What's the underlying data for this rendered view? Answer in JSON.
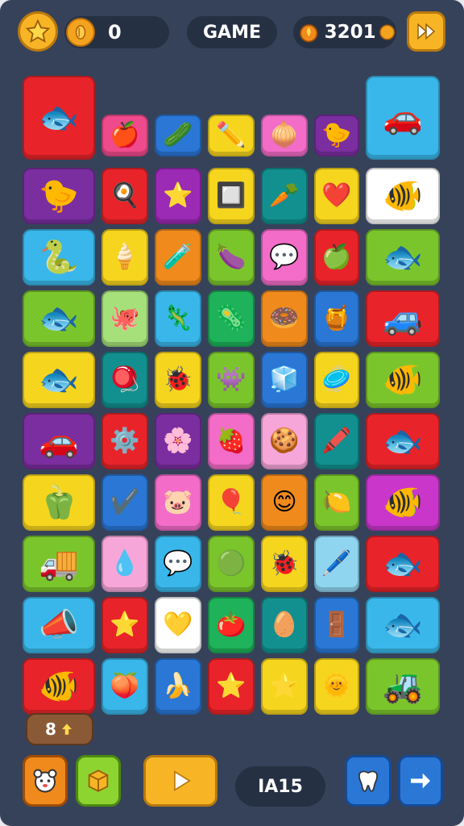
{
  "topbar": {
    "star_icon": "star-icon",
    "coins": "0",
    "title": "GAME",
    "score": "3201",
    "skip_icon": "skip-icon"
  },
  "board": {
    "rows": [
      [
        {
          "color": "#e8242a",
          "icon": "🐟",
          "span": 2,
          "name": "fish-car-tile"
        },
        {
          "color": "#ef4a8b",
          "icon": "🍎"
        },
        {
          "color": "#2a77d6",
          "icon": "🥒"
        },
        {
          "color": "#f6d51e",
          "icon": "✏️"
        },
        {
          "color": "#f26cc8",
          "icon": "🧅"
        },
        {
          "color": "#7b2ea0",
          "icon": "🐤"
        },
        {
          "color": "#39b7ea",
          "icon": "🚗",
          "span": 2,
          "name": "bird-car-tile"
        }
      ],
      [
        {
          "color": "#7b2ea0",
          "icon": "🐤"
        },
        {
          "color": "#e8242a",
          "icon": "🍳"
        },
        {
          "color": "#9b2ab4",
          "icon": "⭐"
        },
        {
          "color": "#f6d51e",
          "icon": "🔲"
        },
        {
          "color": "#12908f",
          "icon": "🥕"
        },
        {
          "color": "#f6d51e",
          "icon": "❤️"
        },
        {
          "color": "#ffffff",
          "icon": "🐠"
        }
      ],
      [
        {
          "color": "#39b7ea",
          "icon": "🐍"
        },
        {
          "color": "#f6d51e",
          "icon": "🍦"
        },
        {
          "color": "#f08a1c",
          "icon": "🧪"
        },
        {
          "color": "#7bc52c",
          "icon": "🍆"
        },
        {
          "color": "#f26cc8",
          "icon": "💬"
        },
        {
          "color": "#e8242a",
          "icon": "🍏"
        },
        {
          "color": "#7bc52c",
          "icon": "🐟"
        }
      ],
      [
        {
          "color": "#7bc52c",
          "icon": "🐟"
        },
        {
          "color": "#a5e07a",
          "icon": "🐙"
        },
        {
          "color": "#39b7ea",
          "icon": "🦎"
        },
        {
          "color": "#1eb25a",
          "icon": "🦠"
        },
        {
          "color": "#f08a1c",
          "icon": "🍩"
        },
        {
          "color": "#2a77d6",
          "icon": "🍯"
        },
        {
          "color": "#e8242a",
          "icon": "🚙"
        }
      ],
      [
        {
          "color": "#f6d51e",
          "icon": "🐟"
        },
        {
          "color": "#12908f",
          "icon": "🪀"
        },
        {
          "color": "#f6d51e",
          "icon": "🐞"
        },
        {
          "color": "#7bc52c",
          "icon": "👾"
        },
        {
          "color": "#2a77d6",
          "icon": "🧊"
        },
        {
          "color": "#f6d51e",
          "icon": "🥏"
        },
        {
          "color": "#7bc52c",
          "icon": "🐠"
        }
      ],
      [
        {
          "color": "#7b2ea0",
          "icon": "🚗"
        },
        {
          "color": "#e8242a",
          "icon": "⚙️"
        },
        {
          "color": "#7b2ea0",
          "icon": "🌸"
        },
        {
          "color": "#f26cc8",
          "icon": "🍓"
        },
        {
          "color": "#f6a6d8",
          "icon": "🍪"
        },
        {
          "color": "#12908f",
          "icon": "🖍️"
        },
        {
          "color": "#e8242a",
          "icon": "🐟"
        }
      ],
      [
        {
          "color": "#f6d51e",
          "icon": "🫑"
        },
        {
          "color": "#2a77d6",
          "icon": "✔️"
        },
        {
          "color": "#f26cc8",
          "icon": "🐷"
        },
        {
          "color": "#f6d51e",
          "icon": "🎈"
        },
        {
          "color": "#f08a1c",
          "icon": "😊"
        },
        {
          "color": "#7bc52c",
          "icon": "🍋"
        },
        {
          "color": "#c936c9",
          "icon": "🐠"
        }
      ],
      [
        {
          "color": "#7bc52c",
          "icon": "🚚"
        },
        {
          "color": "#f6a6d8",
          "icon": "💧"
        },
        {
          "color": "#39b7ea",
          "icon": "💬"
        },
        {
          "color": "#7bc52c",
          "icon": "🟢"
        },
        {
          "color": "#f6d51e",
          "icon": "🐞"
        },
        {
          "color": "#8fd5f0",
          "icon": "🖊️"
        },
        {
          "color": "#e8242a",
          "icon": "🐟"
        }
      ],
      [
        {
          "color": "#39b7ea",
          "icon": "📣"
        },
        {
          "color": "#e8242a",
          "icon": "⭐"
        },
        {
          "color": "#ffffff",
          "icon": "💛"
        },
        {
          "color": "#1eb25a",
          "icon": "🍅"
        },
        {
          "color": "#12908f",
          "icon": "🥚"
        },
        {
          "color": "#2a77d6",
          "icon": "🚪"
        },
        {
          "color": "#39b7ea",
          "icon": "🐟"
        }
      ],
      [
        {
          "color": "#e8242a",
          "icon": "🐠"
        },
        {
          "color": "#39b7ea",
          "icon": "🍑"
        },
        {
          "color": "#2a77d6",
          "icon": "🍌"
        },
        {
          "color": "#e8242a",
          "icon": "⭐"
        },
        {
          "color": "#f6d51e",
          "icon": "⭐"
        },
        {
          "color": "#f6d51e",
          "icon": "🌞"
        },
        {
          "color": "#7bc52c",
          "icon": "🚜"
        }
      ]
    ]
  },
  "bottom": {
    "hint_label": "8",
    "level": "IA15"
  }
}
